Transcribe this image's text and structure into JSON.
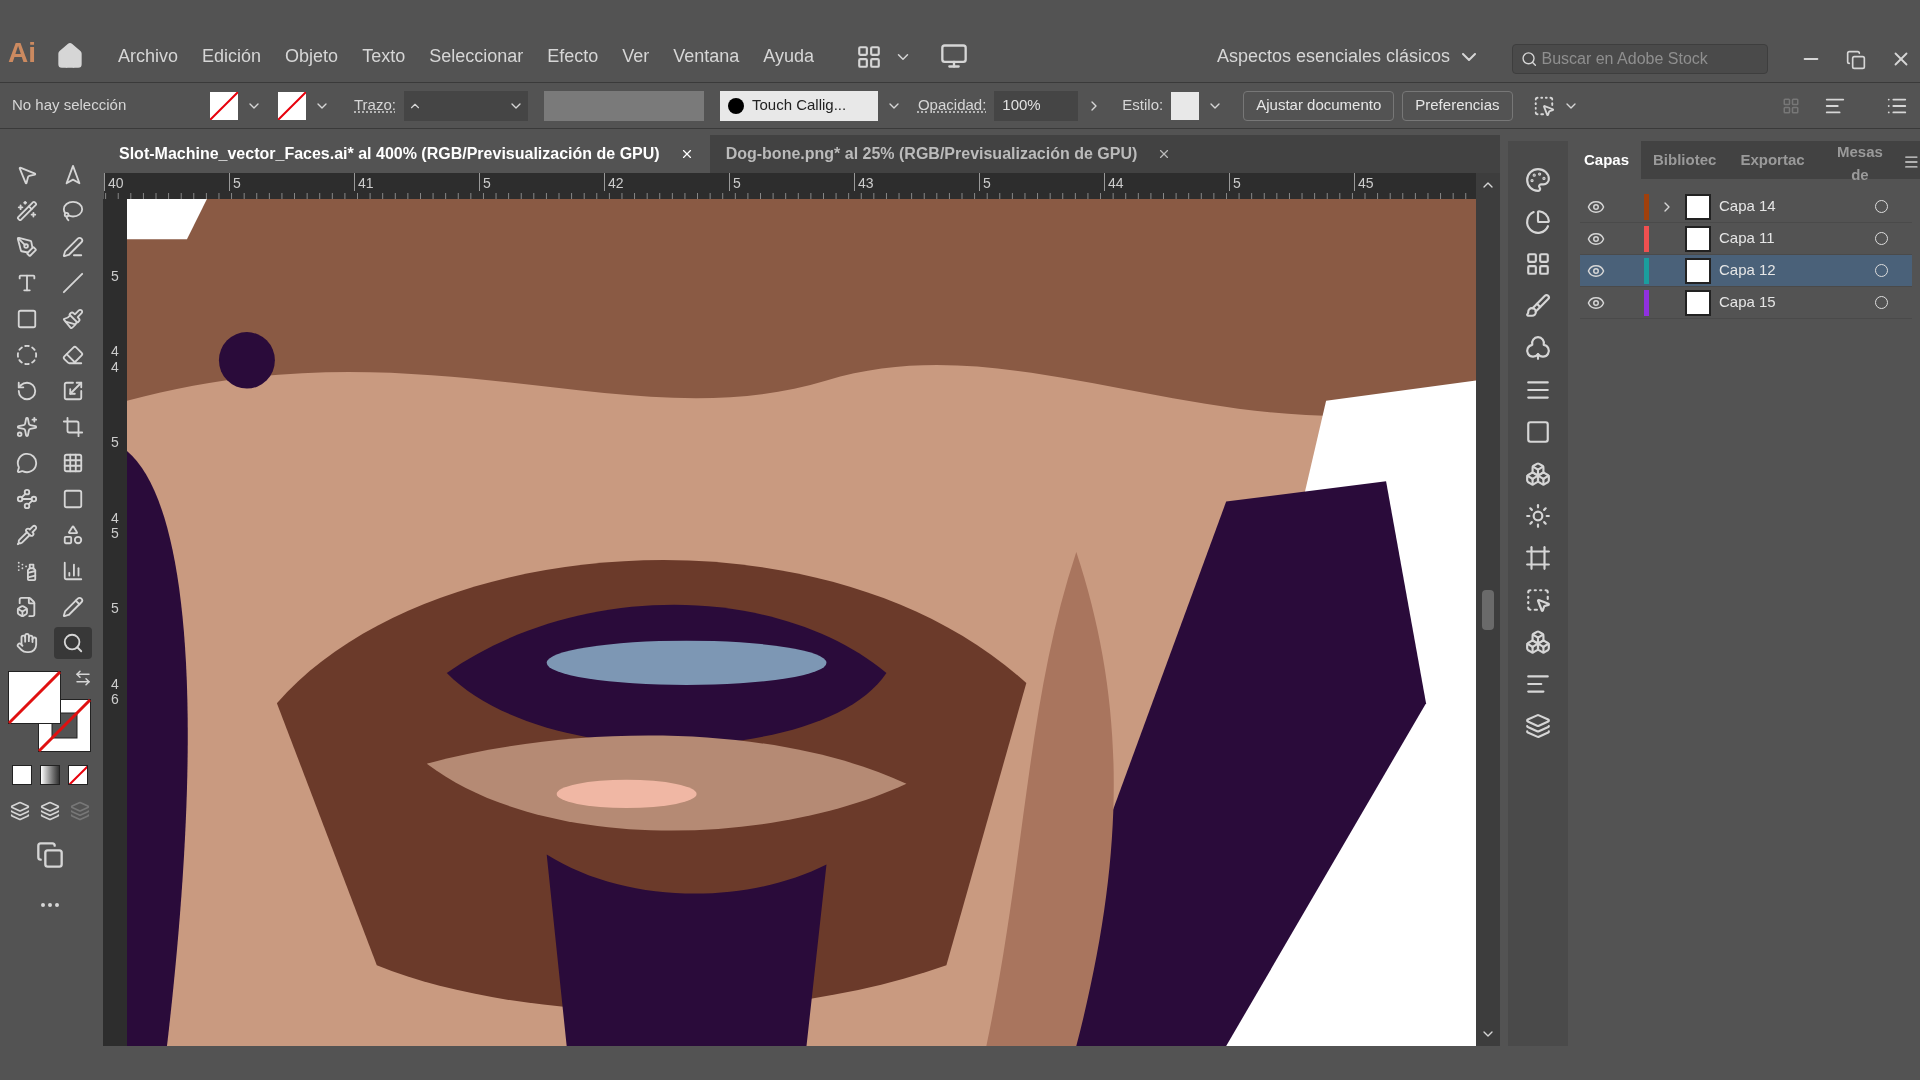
{
  "app": {
    "logo": "Ai"
  },
  "menu": [
    "Archivo",
    "Edición",
    "Objeto",
    "Texto",
    "Seleccionar",
    "Efecto",
    "Ver",
    "Ventana",
    "Ayuda"
  ],
  "workspace": "Aspectos esenciales clásicos",
  "search": {
    "placeholder": "Buscar en Adobe Stock"
  },
  "control_bar": {
    "selection": "No hay selección",
    "stroke_label": "Trazo:",
    "brush": "Touch Callig...",
    "opacity_label": "Opacidad:",
    "opacity": "100%",
    "style_label": "Estilo:",
    "buttons": [
      "Ajustar documento",
      "Preferencias"
    ]
  },
  "documents": [
    {
      "title": "Slot-Machine_vector_Faces.ai* al 400% (RGB/Previsualización de GPU)",
      "selected": true
    },
    {
      "title": "Dog-bone.png* al 25% (RGB/Previsualización de GPU)",
      "selected": false
    }
  ],
  "ruler_h": [
    "40",
    "5",
    "41",
    "5",
    "42",
    "5",
    "43",
    "5",
    "44",
    "5",
    "45"
  ],
  "ruler_v": [
    "5",
    "44",
    "5",
    "45",
    "5",
    "46"
  ],
  "tools": [
    {
      "selected": false
    },
    {
      "selected": false
    },
    {
      "selected": false
    },
    {
      "selected": false
    },
    {
      "selected": false
    },
    {
      "selected": false
    },
    {
      "selected": false
    },
    {
      "selected": false
    },
    {
      "selected": false
    },
    {
      "selected": false
    },
    {
      "selected": false
    },
    {
      "selected": false
    },
    {
      "selected": false
    },
    {
      "selected": false
    },
    {
      "selected": false
    },
    {
      "selected": false
    },
    {
      "selected": false
    },
    {
      "selected": false
    },
    {
      "selected": false
    },
    {
      "selected": false
    },
    {
      "selected": false
    },
    {
      "selected": false
    },
    {
      "selected": false
    },
    {
      "selected": false
    },
    {
      "selected": false
    },
    {
      "selected": false
    },
    {
      "selected": false
    },
    {
      "selected": true
    }
  ],
  "panel": {
    "tabs": [
      {
        "label": "Capas",
        "selected": true
      },
      {
        "label": "Bibliotec",
        "selected": false
      },
      {
        "label": "Exportac",
        "selected": false
      },
      {
        "label": "Mesas de",
        "selected": false
      }
    ],
    "layers": [
      {
        "name": "Capa 14",
        "color": "#a0400c",
        "visible": true,
        "expandable": true,
        "selected": false
      },
      {
        "name": "Capa 11",
        "color": "#f05050",
        "visible": true,
        "expandable": false,
        "selected": false
      },
      {
        "name": "Capa 12",
        "color": "#1a9e9e",
        "visible": true,
        "expandable": false,
        "selected": true
      },
      {
        "name": "Capa 15",
        "color": "#9030e0",
        "visible": true,
        "expandable": false,
        "selected": false
      }
    ]
  }
}
